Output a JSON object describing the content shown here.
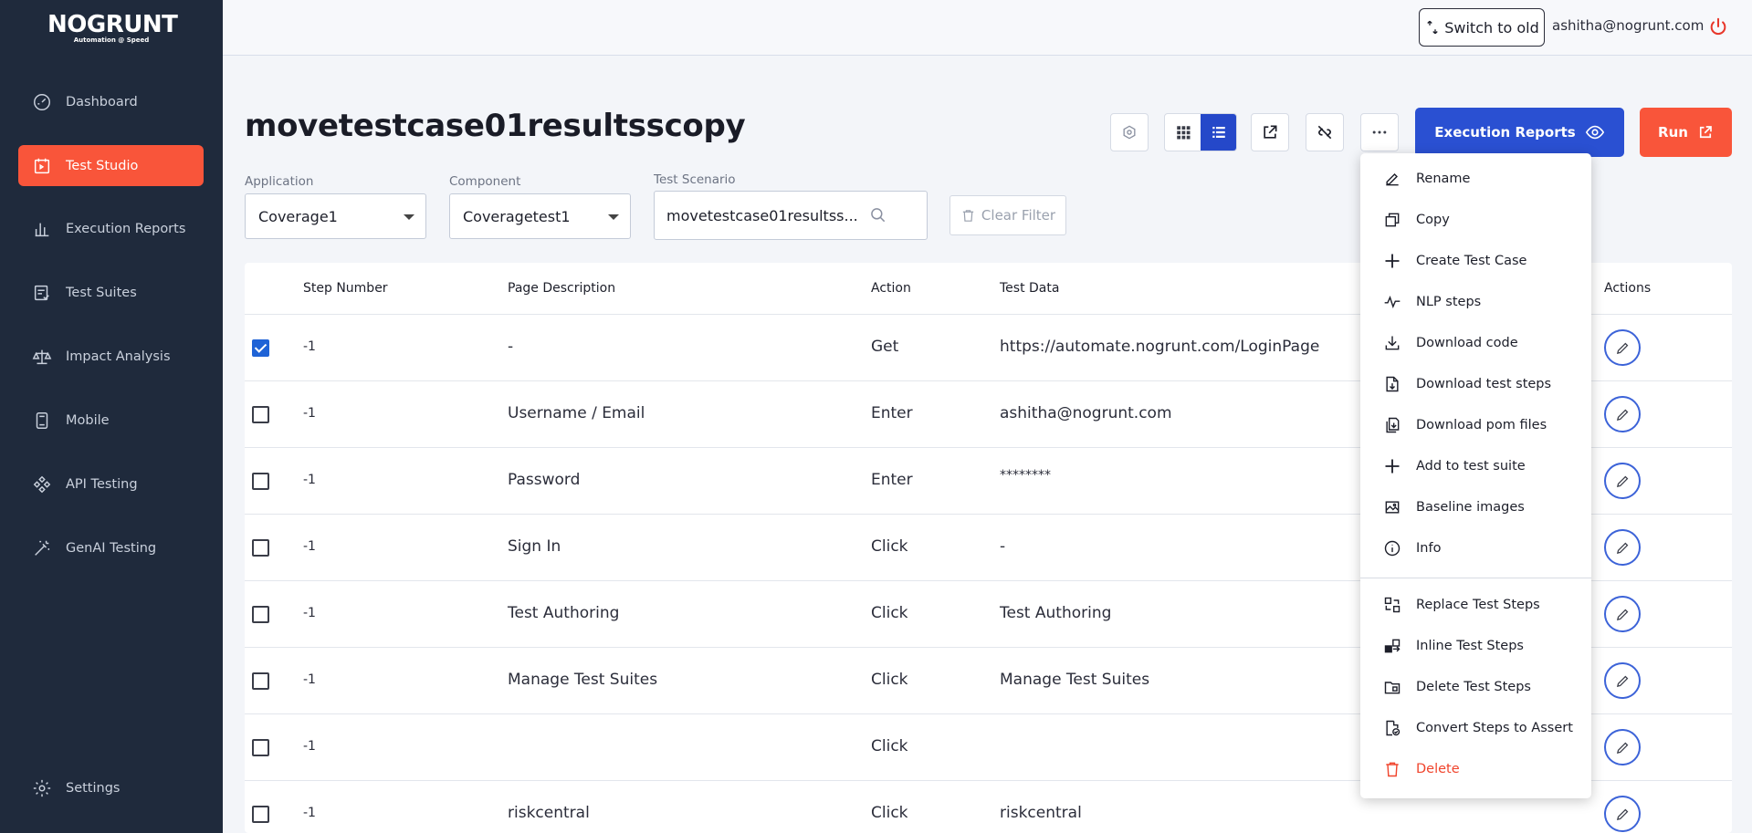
{
  "logo": {
    "main": "NOGRUNT",
    "sub": "Automation @ Speed"
  },
  "sidebar": {
    "items": [
      {
        "label": "Dashboard",
        "icon": "dashboard-gauge-icon"
      },
      {
        "label": "Test Studio",
        "icon": "test-studio-icon",
        "active": true
      },
      {
        "label": "Execution Reports",
        "icon": "bar-chart-icon"
      },
      {
        "label": "Test Suites",
        "icon": "checklist-icon"
      },
      {
        "label": "Impact Analysis",
        "icon": "scale-icon"
      },
      {
        "label": "Mobile",
        "icon": "mobile-icon"
      },
      {
        "label": "API Testing",
        "icon": "api-icon"
      },
      {
        "label": "GenAI Testing",
        "icon": "magic-wand-icon"
      }
    ],
    "settings_label": "Settings"
  },
  "header": {
    "switch_label": "Switch to old",
    "user_email": "ashitha@nogrunt.com"
  },
  "page": {
    "title": "movetestcase01resultsscopy",
    "exec_reports_label": "Execution Reports",
    "run_label": "Run"
  },
  "filters": {
    "application_label": "Application",
    "application_value": "Coverage1",
    "component_label": "Component",
    "component_value": "Coveragetest1",
    "scenario_label": "Test Scenario",
    "scenario_value": "movetestcase01resultss...",
    "clear_label": "Clear Filter"
  },
  "table": {
    "headers": {
      "step": "Step Number",
      "page": "Page Description",
      "action": "Action",
      "data": "Test Data",
      "actions": "Actions"
    },
    "rows": [
      {
        "checked": true,
        "step": "-1",
        "page": "-",
        "action": "Get",
        "data": "https://automate.nogrunt.com/LoginPage"
      },
      {
        "checked": false,
        "step": "-1",
        "page": "Username / Email",
        "action": "Enter",
        "data": "ashitha@nogrunt.com"
      },
      {
        "checked": false,
        "step": "-1",
        "page": "Password",
        "action": "Enter",
        "data": "********"
      },
      {
        "checked": false,
        "step": "-1",
        "page": "Sign In",
        "action": "Click",
        "data": "-"
      },
      {
        "checked": false,
        "step": "-1",
        "page": "Test Authoring",
        "action": "Click",
        "data": "Test Authoring"
      },
      {
        "checked": false,
        "step": "-1",
        "page": "Manage Test Suites",
        "action": "Click",
        "data": "Manage Test Suites"
      },
      {
        "checked": false,
        "step": "-1",
        "page": "",
        "action": "Click",
        "data": ""
      },
      {
        "checked": false,
        "step": "-1",
        "page": "riskcentral",
        "action": "Click",
        "data": "riskcentral"
      }
    ]
  },
  "menu": {
    "items": [
      {
        "label": "Rename",
        "icon": "pen-icon"
      },
      {
        "label": "Copy",
        "icon": "copy-icon"
      },
      {
        "label": "Create Test Case",
        "icon": "plus-icon"
      },
      {
        "label": "NLP steps",
        "icon": "pulse-icon"
      },
      {
        "label": "Download code",
        "icon": "download-icon"
      },
      {
        "label": "Download test steps",
        "icon": "file-download-icon"
      },
      {
        "label": "Download pom files",
        "icon": "files-download-icon"
      },
      {
        "label": "Add to test suite",
        "icon": "plus-icon"
      },
      {
        "label": "Baseline images",
        "icon": "image-icon"
      },
      {
        "label": "Info",
        "icon": "info-icon"
      },
      {
        "label": "Replace Test Steps",
        "icon": "replace-icon"
      },
      {
        "label": "Inline Test Steps",
        "icon": "inline-icon"
      },
      {
        "label": "Delete Test Steps",
        "icon": "folder-delete-icon"
      },
      {
        "label": "Convert Steps to Assert",
        "icon": "file-check-icon"
      },
      {
        "label": "Delete",
        "icon": "trash-icon",
        "danger": true
      }
    ]
  },
  "colors": {
    "sidebar_bg": "#1f2a3c",
    "accent_orange": "#f9553a",
    "accent_blue": "#2a50d2",
    "danger": "#f0442c"
  }
}
